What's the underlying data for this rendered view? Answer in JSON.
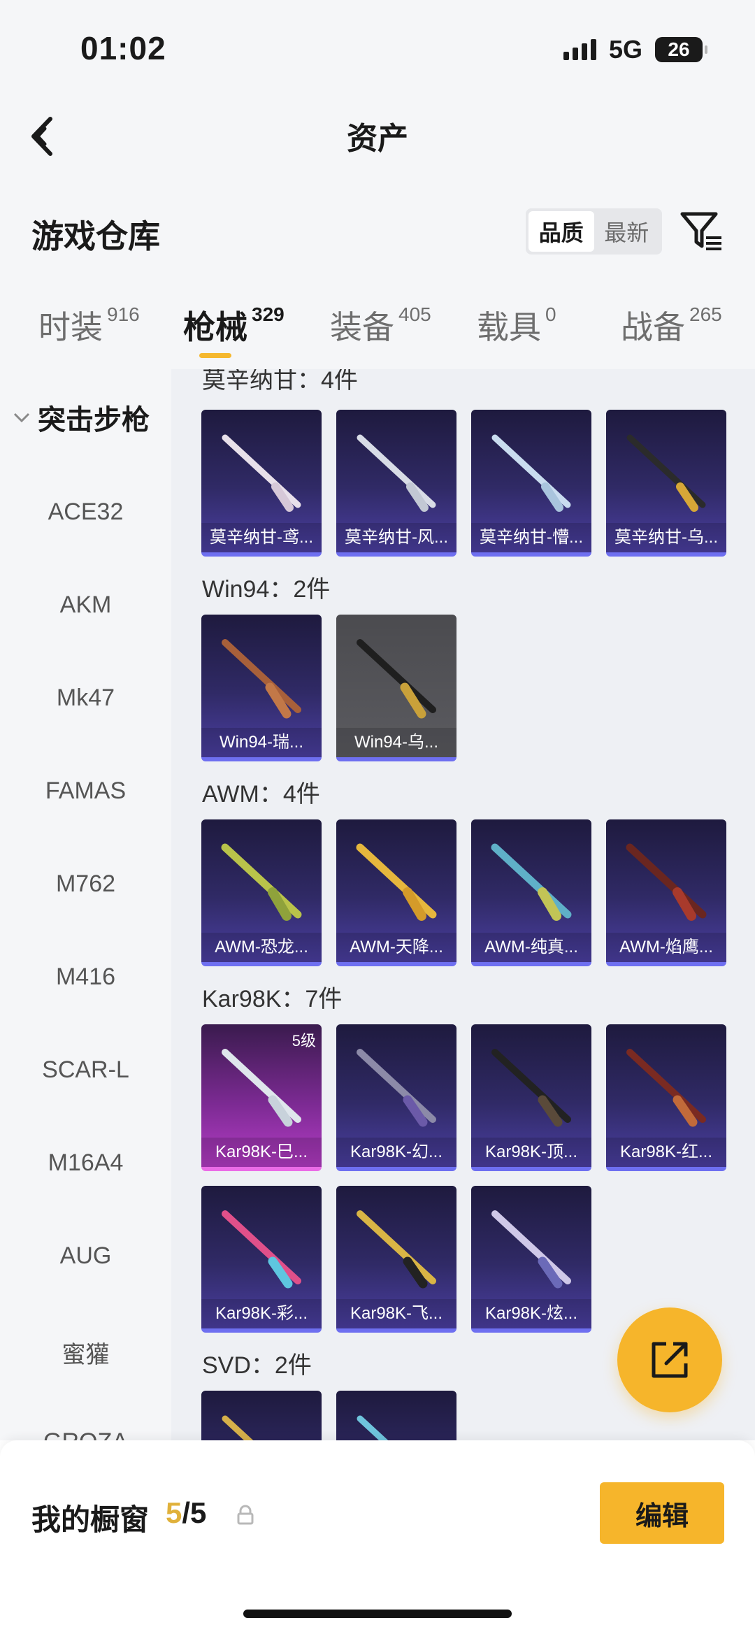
{
  "status": {
    "time": "01:02",
    "network": "5G",
    "battery": "26"
  },
  "nav": {
    "title": "资产"
  },
  "header": {
    "title": "游戏仓库",
    "sort_options": [
      "品质",
      "最新"
    ]
  },
  "tabs": [
    {
      "label": "时装",
      "count": "916"
    },
    {
      "label": "枪械",
      "count": "329"
    },
    {
      "label": "装备",
      "count": "405"
    },
    {
      "label": "载具",
      "count": "0"
    },
    {
      "label": "战备",
      "count": "265"
    }
  ],
  "sidebar": {
    "category": "突击步枪",
    "items": [
      "ACE32",
      "AKM",
      "Mk47",
      "FAMAS",
      "M762",
      "M416",
      "SCAR-L",
      "M16A4",
      "AUG",
      "蜜獾",
      "GROZA"
    ]
  },
  "sections": [
    {
      "title": "莫辛纳甘：4件",
      "items": [
        "莫辛纳甘-鸢...",
        "莫辛纳甘-风...",
        "莫辛纳甘-懵...",
        "莫辛纳甘-乌..."
      ]
    },
    {
      "title": "Win94：2件",
      "items": [
        "Win94-瑞...",
        "Win94-乌..."
      ]
    },
    {
      "title": "AWM：4件",
      "items": [
        "AWM-恐龙...",
        "AWM-天降...",
        "AWM-纯真...",
        "AWM-焰鹰..."
      ]
    },
    {
      "title": "Kar98K：7件",
      "level_badge": "5级",
      "items": [
        "Kar98K-巳...",
        "Kar98K-幻...",
        "Kar98K-顶...",
        "Kar98K-红...",
        "Kar98K-彩...",
        "Kar98K-飞...",
        "Kar98K-炫..."
      ]
    },
    {
      "title": "SVD：2件"
    }
  ],
  "bottom": {
    "title": "我的橱窗",
    "current": "5",
    "total": "/5",
    "edit": "编辑"
  },
  "colors": {
    "accent": "#f6b52b",
    "card_purple": "#302a66",
    "card_pink": "#b43cc5"
  }
}
